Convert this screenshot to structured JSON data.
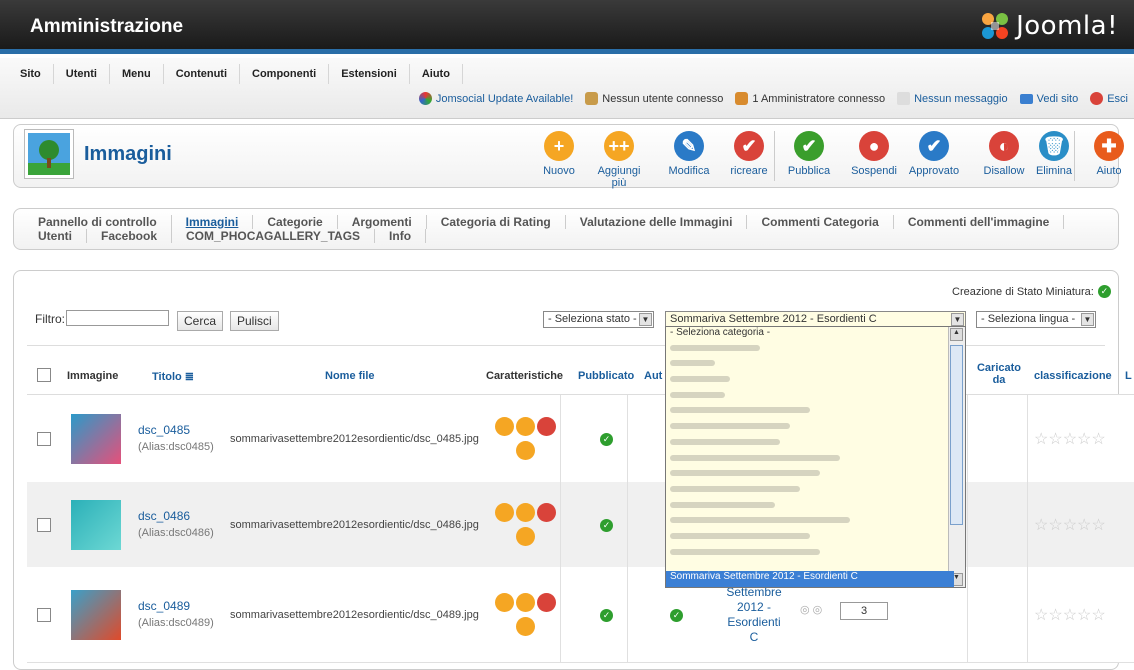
{
  "header": {
    "title": "Amministrazione",
    "logo_text": "Joomla!"
  },
  "menu": [
    "Sito",
    "Utenti",
    "Menu",
    "Contenuti",
    "Componenti",
    "Estensioni",
    "Aiuto"
  ],
  "status": [
    "Jomsocial Update Available!",
    "Nessun utente connesso",
    "1 Amministratore connesso",
    "Nessun messaggio",
    "Vedi sito",
    "Esci"
  ],
  "page": {
    "title": "Immagini"
  },
  "toolbar": [
    {
      "label": "Nuovo",
      "color": "#f5a623",
      "glyph": "+"
    },
    {
      "label": "Aggiungi più",
      "color": "#f5a623",
      "glyph": "++"
    },
    {
      "label": "Modifica",
      "color": "#2a7ac7",
      "glyph": "✎"
    },
    {
      "label": "ricreare",
      "color": "#d9433a",
      "glyph": "✔"
    },
    {
      "label": "Pubblica",
      "color": "#3a9e2c",
      "glyph": "✔"
    },
    {
      "label": "Sospendi",
      "color": "#d9433a",
      "glyph": "●"
    },
    {
      "label": "Approvato",
      "color": "#2a7ac7",
      "glyph": "✔"
    },
    {
      "label": "Disallow",
      "color": "#d9433a",
      "glyph": "◐"
    },
    {
      "label": "Elimina",
      "color": "#2a8ec7",
      "glyph": "🗑"
    },
    {
      "label": "Aiuto",
      "color": "#e85b1c",
      "glyph": "✚"
    }
  ],
  "subnav": {
    "row1": [
      "Pannello di controllo",
      "Immagini",
      "Categorie",
      "Argomenti",
      "Categoria di Rating",
      "Valutazione delle Immagini",
      "Commenti Categoria",
      "Commenti dell'immagine"
    ],
    "row2": [
      "Utenti",
      "Facebook",
      "COM_PHOCAGALLERY_TAGS",
      "Info"
    ]
  },
  "filter": {
    "label": "Filtro:",
    "value": "",
    "search_btn": "Cerca",
    "clear_btn": "Pulisci"
  },
  "thumb_status": "Creazione di Stato Miniatura:",
  "selects": {
    "state": "- Seleziona stato -",
    "category": "Sommariva Settembre 2012 - Esordienti C",
    "language": "- Seleziona lingua -"
  },
  "dropdown": {
    "first": "- Seleziona categoria -",
    "selected": "Sommariva Settembre 2012 - Esordienti C"
  },
  "columns": [
    "Immagine",
    "Titolo",
    "Nome file",
    "Caratteristiche",
    "Pubblicato",
    "Aut",
    "Caricato da",
    "classificazione",
    "L"
  ],
  "rows": [
    {
      "title": "dsc_0485",
      "alias": "(Alias:dsc0485)",
      "file": "sommarivasettembre2012esordientic/dsc_0485.jpg"
    },
    {
      "title": "dsc_0486",
      "alias": "(Alias:dsc0486)",
      "file": "sommarivasettembre2012esordientic/dsc_0486.jpg"
    },
    {
      "title": "dsc_0489",
      "alias": "(Alias:dsc0489)",
      "file": "sommarivasettembre2012esordientic/dsc_0489.jpg",
      "category_lines": [
        "Settembre",
        "2012 -",
        "Esordienti",
        "C"
      ],
      "order": "3"
    }
  ]
}
